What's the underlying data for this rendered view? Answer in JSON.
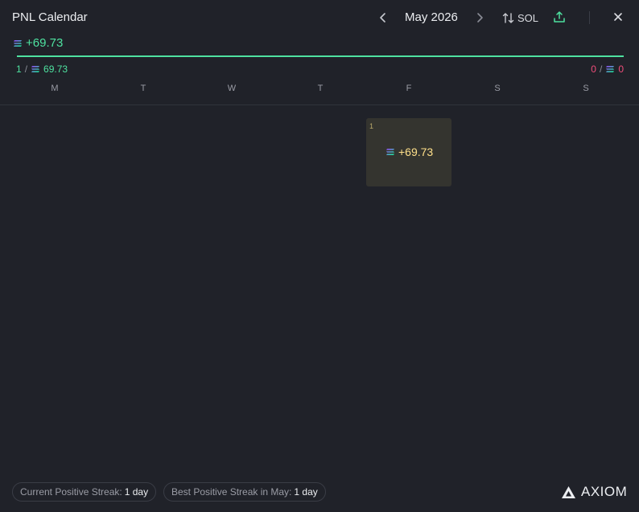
{
  "header": {
    "title": "PNL Calendar",
    "month_label": "May 2026",
    "currency_label": "SOL"
  },
  "summary": {
    "total_pnl": "+69.73",
    "positive_days": "1",
    "positive_amount": "69.73",
    "negative_days": "0",
    "negative_amount": "0",
    "positive_share": 1.0
  },
  "weekdays": [
    "M",
    "T",
    "W",
    "T",
    "F",
    "S",
    "S"
  ],
  "days": [
    {
      "day": "1",
      "pnl": "+69.73"
    }
  ],
  "footer": {
    "current_streak_label": "Current Positive Streak:",
    "current_streak_value": "1 day",
    "best_streak_label": "Best Positive Streak in May:",
    "best_streak_value": "1 day",
    "brand": "AXIOM"
  },
  "colors": {
    "positive": "#4ee2a0",
    "negative": "#ef4d7a",
    "day_highlight": "#ffe08a"
  },
  "icons": {
    "prev": "chevron-left-icon",
    "next": "chevron-right-icon",
    "swap": "swap-vertical-icon",
    "export": "upload-icon",
    "close": "close-icon",
    "currency": "solana-icon"
  }
}
